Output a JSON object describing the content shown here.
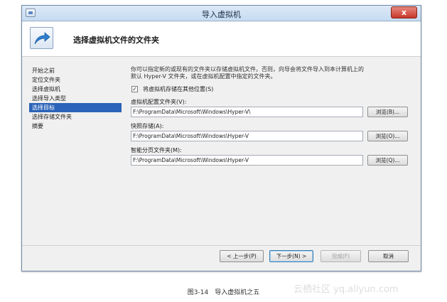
{
  "window": {
    "title": "导入虚拟机",
    "close_label": "x"
  },
  "header": {
    "title": "选择虚拟机文件的文件夹",
    "icon": "arrow-icon"
  },
  "nav": {
    "items": [
      {
        "label": "开始之前"
      },
      {
        "label": "定位文件夹"
      },
      {
        "label": "选择虚拟机"
      },
      {
        "label": "选择导入类型"
      },
      {
        "label": "选择目标",
        "active": true
      },
      {
        "label": "选择存储文件夹"
      },
      {
        "label": "摘要"
      }
    ]
  },
  "content": {
    "description_line1": "你可以指定新的或现有的文件夹以存储虚拟机文件。否则，向导会将文件导入到本计算机上的",
    "description_line2": "默认 Hyper-V 文件夹，或在虚拟机配置中指定的文件夹。",
    "checkbox_label": "将虚拟机存储在其他位置(S)",
    "checkbox_checked": true,
    "checkbox_mark": "✓",
    "fields": [
      {
        "label": "虚拟机配置文件夹(V):",
        "value": "F:\\ProgramData\\Microsoft\\Windows\\Hyper-V\\",
        "browse": "浏览(B)..."
      },
      {
        "label": "快照存储(A):",
        "value": "F:\\ProgramData\\Microsoft\\Windows\\Hyper-V",
        "browse": "浏览(O)..."
      },
      {
        "label": "智能分页文件夹(M):",
        "value": "F:\\ProgramData\\Microsoft\\Windows\\Hyper-V",
        "browse": "浏览(Q)..."
      }
    ]
  },
  "footer": {
    "prev": "< 上一步(P)",
    "next": "下一步(N) >",
    "finish": "完成(F)",
    "cancel": "取消"
  },
  "caption": "图3-14　导入虚拟机之五",
  "watermark": "云栖社区 yq.aliyun.com",
  "colors": {
    "selection": "#2b63b8",
    "titlebar": "#c7dbf1",
    "close": "#c7382a",
    "icon_arrow": "#2e7fd0"
  }
}
